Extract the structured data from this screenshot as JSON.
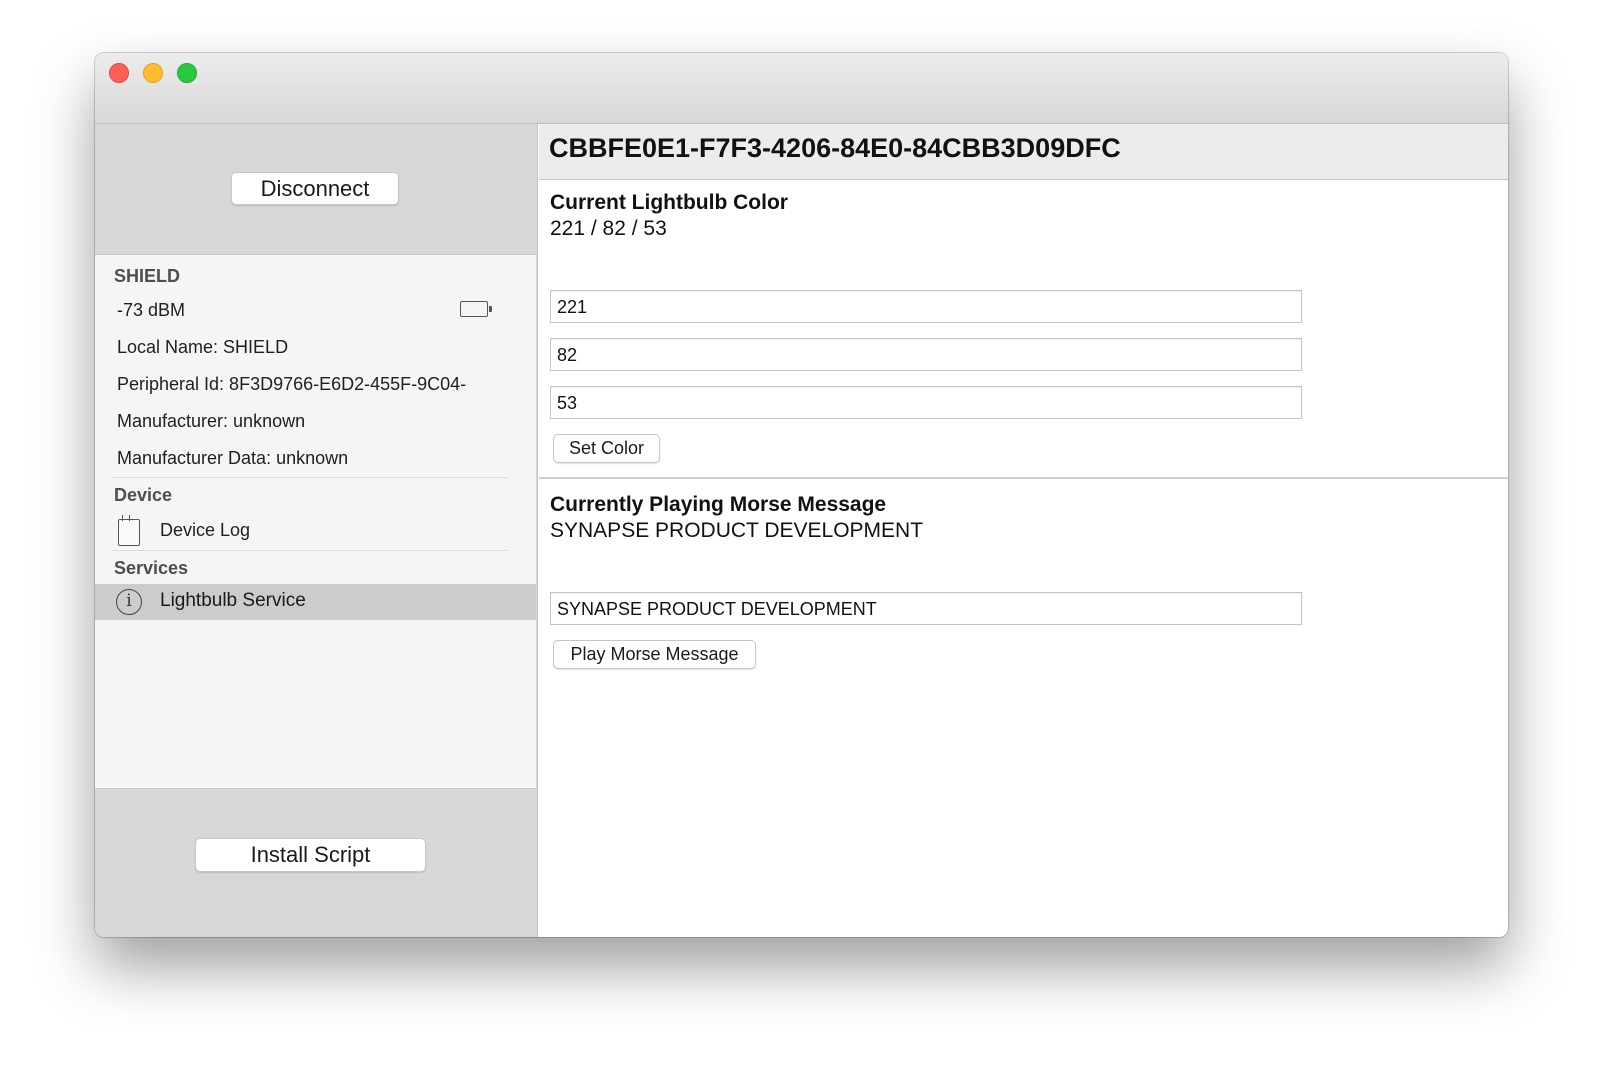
{
  "sidebar": {
    "disconnect_label": "Disconnect",
    "install_label": "Install Script",
    "peripheral_section": "SHIELD",
    "rssi": "-73 dBM",
    "local_name": "Local Name: SHIELD",
    "peripheral_id": "Peripheral Id: 8F3D9766-E6D2-455F-9C04-",
    "manufacturer": "Manufacturer: unknown",
    "manufacturer_data": "Manufacturer Data: unknown",
    "device_section": "Device",
    "device_log_label": "Device Log",
    "services_section": "Services",
    "lightbulb_service_label": "Lightbulb Service"
  },
  "main": {
    "title": "CBBFE0E1-F7F3-4206-84E0-84CBB3D09DFC",
    "color": {
      "heading": "Current Lightbulb Color",
      "value": "221 / 82 / 53",
      "red_value": "221",
      "green_value": "82",
      "blue_value": "53",
      "set_label": "Set Color"
    },
    "morse": {
      "heading": "Currently Playing Morse Message",
      "value": "SYNAPSE PRODUCT DEVELOPMENT",
      "input_value": "SYNAPSE PRODUCT DEVELOPMENT",
      "play_label": "Play Morse Message"
    }
  },
  "icons": {
    "battery": "battery-icon",
    "document": "document-icon",
    "info": "info-icon"
  }
}
